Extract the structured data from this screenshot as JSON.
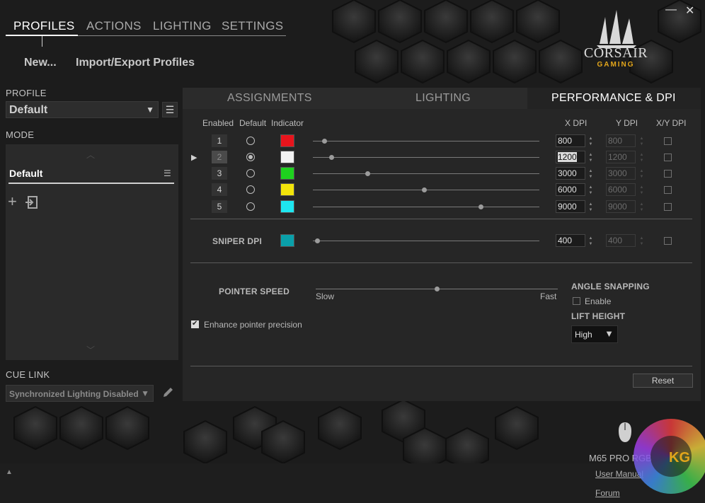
{
  "colors": {
    "background": "#1c1c1c",
    "panel": "#262626",
    "accent_gold": "#e3a61b"
  },
  "window": {
    "minimize_label": "—",
    "close_label": "✕"
  },
  "nav": {
    "tabs": [
      {
        "label": "PROFILES",
        "active": true
      },
      {
        "label": "ACTIONS",
        "active": false
      },
      {
        "label": "LIGHTING",
        "active": false
      },
      {
        "label": "SETTINGS",
        "active": false
      }
    ],
    "sub": {
      "new_label": "New...",
      "import_export_label": "Import/Export Profiles"
    }
  },
  "brand": {
    "name": "CORSAIR",
    "tagline": "GAMING",
    "logo_icon": "sails-logo-icon"
  },
  "profile": {
    "label": "PROFILE",
    "selected": "Default",
    "menu_icon": "hamburger-icon"
  },
  "mode": {
    "label": "MODE",
    "items": [
      {
        "label": "Default"
      }
    ],
    "icons": [
      "add-icon",
      "import-icon"
    ]
  },
  "cue_link": {
    "label": "CUE LINK",
    "selected": "Synchronized Lighting Disabled",
    "edit_icon": "pencil-icon"
  },
  "tabs": [
    {
      "label": "ASSIGNMENTS",
      "active": false
    },
    {
      "label": "LIGHTING",
      "active": false
    },
    {
      "label": "PERFORMANCE & DPI",
      "active": true
    }
  ],
  "dpi": {
    "headers": {
      "enabled": "Enabled",
      "default": "Default",
      "indicator": "Indicator",
      "x": "X DPI",
      "y": "Y DPI",
      "xy": "X/Y DPI"
    },
    "stages": [
      {
        "num": "1",
        "default": false,
        "color": "#e8141c",
        "x": "800",
        "y": "800",
        "slider": 0.05
      },
      {
        "num": "2",
        "default": true,
        "color": "#f2f2f2",
        "x": "1200",
        "y": "1200",
        "slider": 0.08
      },
      {
        "num": "3",
        "default": false,
        "color": "#1ed21e",
        "x": "3000",
        "y": "3000",
        "slider": 0.24
      },
      {
        "num": "4",
        "default": false,
        "color": "#f2e40a",
        "x": "6000",
        "y": "6000",
        "slider": 0.49
      },
      {
        "num": "5",
        "default": false,
        "color": "#1ee6f0",
        "x": "9000",
        "y": "9000",
        "slider": 0.74
      }
    ],
    "sniper": {
      "label": "SNIPER DPI",
      "color": "#0aa0aa",
      "x": "400",
      "y": "400",
      "slider": 0.02
    }
  },
  "pointer": {
    "label": "POINTER SPEED",
    "slow": "Slow",
    "fast": "Fast",
    "value": 0.5,
    "enhance_label": "Enhance pointer precision",
    "enhance_checked": true
  },
  "angle": {
    "label": "ANGLE SNAPPING",
    "enable_label": "Enable",
    "checked": false
  },
  "lift": {
    "label": "LIFT HEIGHT",
    "selected": "High"
  },
  "reset_label": "Reset",
  "device": {
    "name": "M65 PRO RGB",
    "icon": "mouse-icon"
  },
  "links": {
    "manual": "User Manual",
    "forum": "Forum"
  },
  "collapse_icon": "triangle-up-icon",
  "watermark": "KG"
}
